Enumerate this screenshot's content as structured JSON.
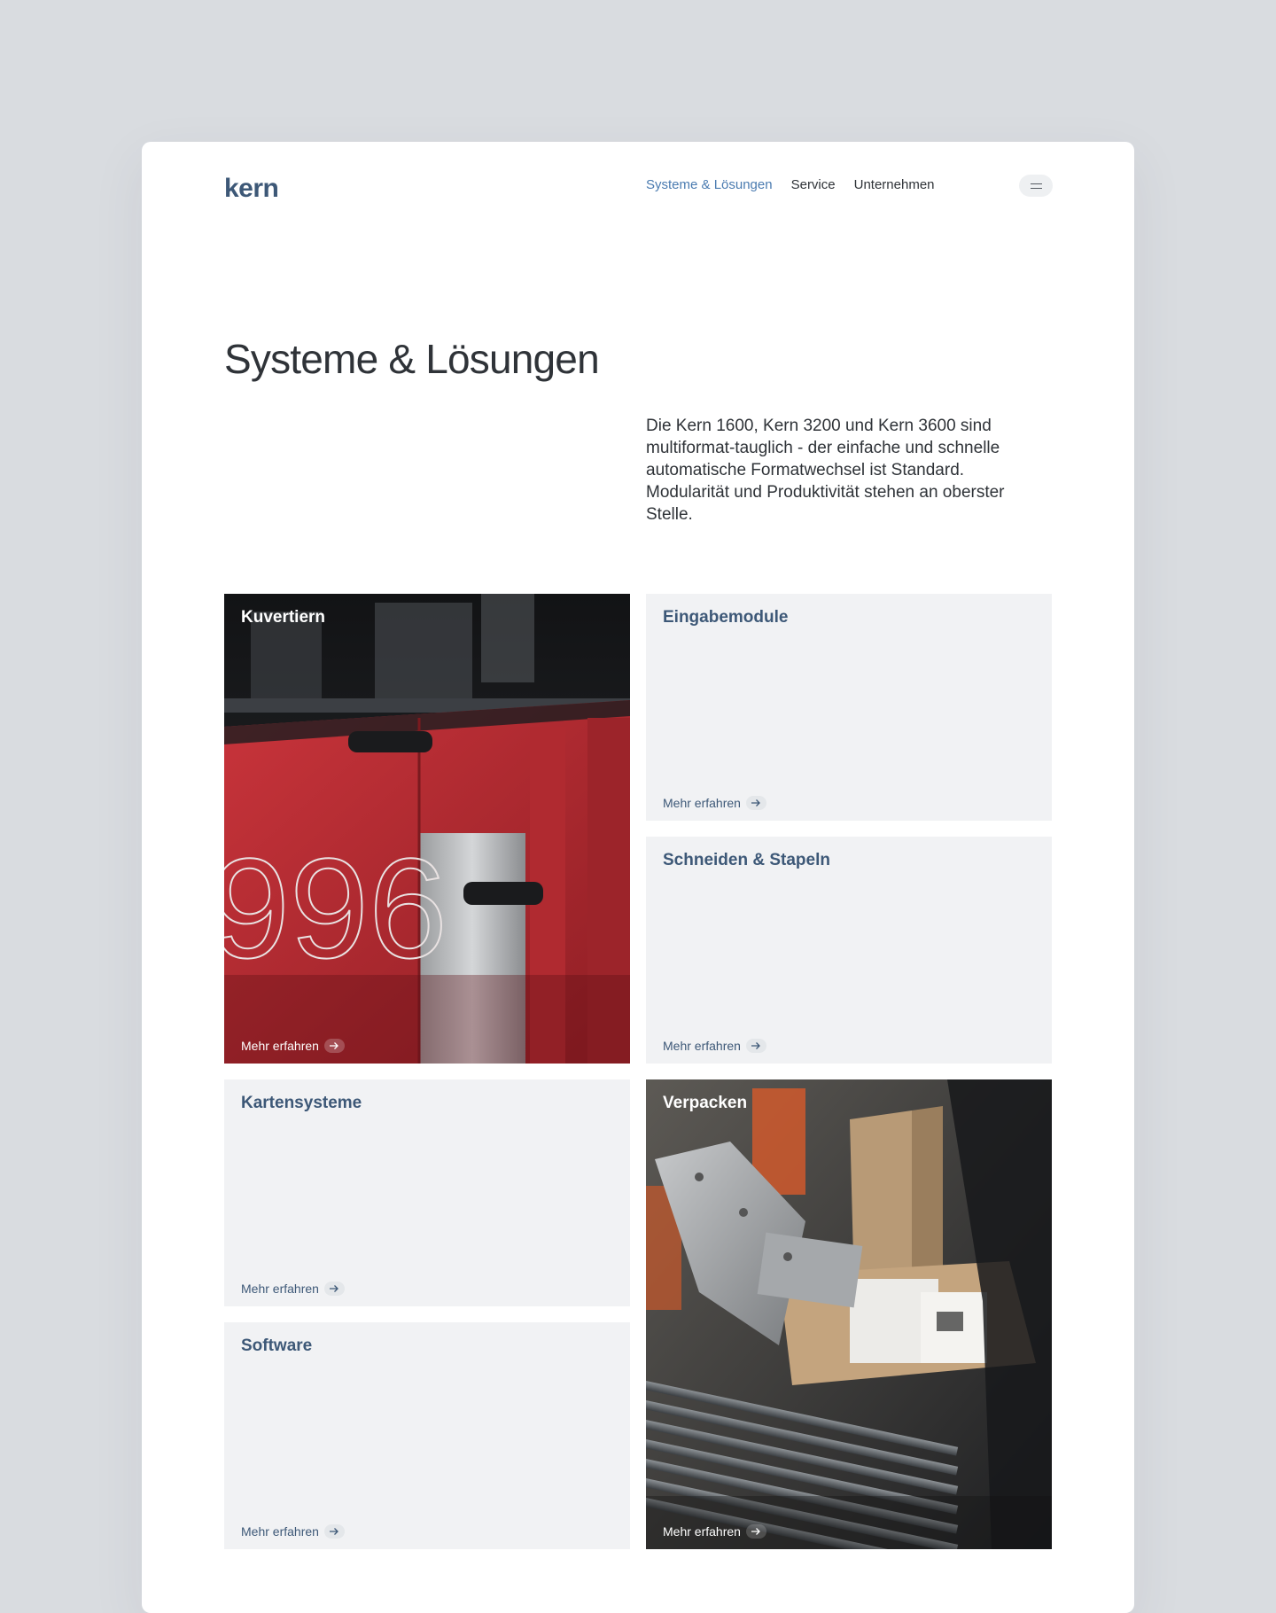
{
  "brand": {
    "logo_text": "kern"
  },
  "nav": {
    "items": [
      {
        "label": "Systeme & Lösungen",
        "active": true
      },
      {
        "label": "Service",
        "active": false
      },
      {
        "label": "Unternehmen",
        "active": false
      }
    ],
    "menu_icon": "hamburger-icon"
  },
  "hero": {
    "title": "Systeme & Lösungen",
    "intro": "Die Kern 1600, Kern 3200 und Kern 3600 sind multiformat-tauglich - der einfache und schnelle automatische Formatwechsel ist Standard. Modularität und Produktivität stehen an oberster Stelle."
  },
  "tiles": [
    {
      "title": "Kuvertiern",
      "cta": "Mehr erfahren",
      "has_image": true
    },
    {
      "title": "Eingabemodule",
      "cta": "Mehr erfahren",
      "has_image": false
    },
    {
      "title": "Schneiden & Stapeln",
      "cta": "Mehr erfahren",
      "has_image": false
    },
    {
      "title": "Kartensysteme",
      "cta": "Mehr erfahren",
      "has_image": false
    },
    {
      "title": "Verpacken",
      "cta": "Mehr erfahren",
      "has_image": true
    },
    {
      "title": "Software",
      "cta": "Mehr erfahren",
      "has_image": false
    }
  ],
  "photo_texts": {
    "machine_number": "996"
  },
  "colors": {
    "page_bg": "#d9dce0",
    "brand_blue": "#3d5877",
    "nav_active": "#4a7bb0",
    "tile_bg": "#f1f2f4",
    "machine_red": "#c8323a"
  }
}
